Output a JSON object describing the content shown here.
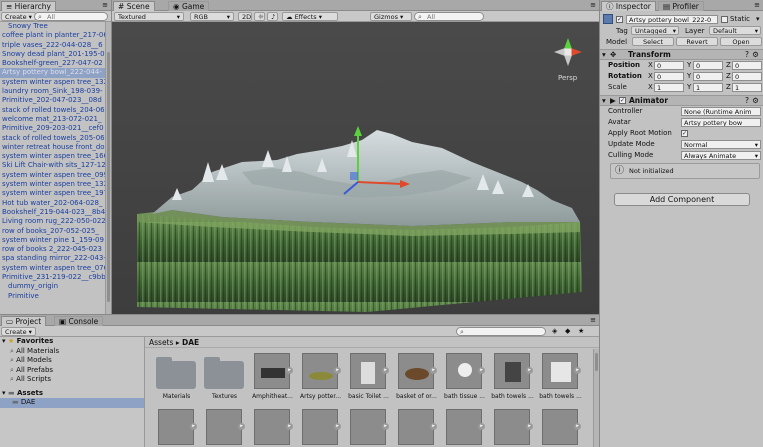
{
  "hierarchy": {
    "tab": "Hierarchy",
    "create": "Create",
    "search": "All",
    "items": [
      {
        "label": "Snowy Tree",
        "indent": true
      },
      {
        "label": "coffee plant in planter_217-06"
      },
      {
        "label": "triple vases_222-044-028__6"
      },
      {
        "label": "Snowy dead plant_201-195-0"
      },
      {
        "label": "Bookshelf-green_227-047-02"
      },
      {
        "label": "Artsy pottery bowl_222-044-"
      },
      {
        "label": "system winter aspen tree_132"
      },
      {
        "label": "laundry room_Sink_198-039-"
      },
      {
        "label": "Primitive_202-047-023__08d"
      },
      {
        "label": "stack of rolled towels_204-06"
      },
      {
        "label": "welcome mat_213-072-021_"
      },
      {
        "label": "Primitive_209-203-021__cef0"
      },
      {
        "label": "stack of rolled towels_205-06"
      },
      {
        "label": "winter retreat house front_do"
      },
      {
        "label": "system winter aspen tree_166"
      },
      {
        "label": "Ski Lift Chair-with sits_127-12"
      },
      {
        "label": "system winter aspen tree_099"
      },
      {
        "label": "system winter aspen tree_132"
      },
      {
        "label": "system winter aspen tree_197"
      },
      {
        "label": "Hot tub water_202-064-028_"
      },
      {
        "label": "Bookshelf_219-044-023__8b4"
      },
      {
        "label": "Living room rug_222-050-022"
      },
      {
        "label": "row of books_207-052-025_"
      },
      {
        "label": "system winter pine 1_159-09"
      },
      {
        "label": "row of books 2_222-045-023"
      },
      {
        "label": "spa standing mirror_222-043-"
      },
      {
        "label": "system winter aspen tree_076"
      },
      {
        "label": "Primitive_231-219-022__c9bb"
      },
      {
        "label": "dummy_origin",
        "indent": true
      },
      {
        "label": "Primitive",
        "indent": true
      }
    ]
  },
  "scene": {
    "tabs": [
      "Scene",
      "Game"
    ],
    "shading": "Textured",
    "color": "RGB",
    "mode2d": "2D",
    "effects": "Effects",
    "gizmos": "Gizmos",
    "search": "All",
    "persp": "Persp"
  },
  "inspector": {
    "tabs": [
      "Inspector",
      "Profiler"
    ],
    "object_name": "Artsy pottery bowl_222-0",
    "static_label": "Static",
    "tag_label": "Tag",
    "tag_value": "Untagged",
    "layer_label": "Layer",
    "layer_value": "Default",
    "model_label": "Model",
    "model_buttons": [
      "Select",
      "Revert",
      "Open"
    ],
    "transform": {
      "title": "Transform",
      "rows": [
        {
          "label": "Position",
          "x": "0",
          "y": "0",
          "z": "0"
        },
        {
          "label": "Rotation",
          "x": "0",
          "y": "0",
          "z": "0"
        },
        {
          "label": "Scale",
          "x": "1",
          "y": "1",
          "z": "1"
        }
      ]
    },
    "animator": {
      "title": "Animator",
      "rows": [
        {
          "label": "Controller",
          "value": "None (Runtime Anim"
        },
        {
          "label": "Avatar",
          "value": "Artsy pottery bow"
        },
        {
          "label": "Apply Root Motion",
          "value": "✓"
        },
        {
          "label": "Update Mode",
          "value": "Normal"
        },
        {
          "label": "Culling Mode",
          "value": "Always Animate"
        }
      ],
      "info": "Not initialized"
    },
    "add_component": "Add Component"
  },
  "project": {
    "tabs": [
      "Project",
      "Console"
    ],
    "create": "Create",
    "favorites_title": "Favorites",
    "favorites": [
      "All Materials",
      "All Models",
      "All Prefabs",
      "All Scripts"
    ],
    "assets_title": "Assets",
    "assets_items": [
      "DAE"
    ],
    "breadcrumb": [
      "Assets",
      "DAE"
    ],
    "row1": [
      {
        "label": "Materials",
        "kind": "folder"
      },
      {
        "label": "Textures",
        "kind": "folder"
      },
      {
        "label": "Amphitheat...",
        "kind": "model"
      },
      {
        "label": "Artsy potter...",
        "kind": "model"
      },
      {
        "label": "basic Toilet ...",
        "kind": "model"
      },
      {
        "label": "basket of or...",
        "kind": "model"
      },
      {
        "label": "bath tissue ...",
        "kind": "model"
      },
      {
        "label": "bath towels ...",
        "kind": "model"
      },
      {
        "label": "bath towels ...",
        "kind": "model"
      }
    ],
    "row2_count": 9
  },
  "colors": {
    "selection": "#8ea2c5",
    "link_blue": "#1b3fa0",
    "terrain_green": "#4a7a3a"
  }
}
